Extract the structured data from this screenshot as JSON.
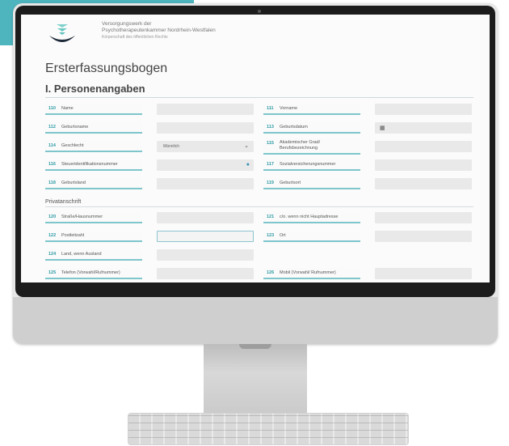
{
  "organization": {
    "line1": "Versorgungswerk der",
    "line2": "Psychotherapeutenkammer Nordrhein-Westfalen",
    "line3": "Körperschaft des öffentlichen Rechts"
  },
  "form": {
    "title": "Ersterfassungsbogen",
    "section": "I. Personenangaben",
    "subsection": "Privatanschrift"
  },
  "fields": [
    {
      "num": "110",
      "label": "Name"
    },
    {
      "num": "111",
      "label": "Vorname"
    },
    {
      "num": "112",
      "label": "Geburtsname"
    },
    {
      "num": "113",
      "label": "Geburtsdatum"
    },
    {
      "num": "114",
      "label": "Geschlecht",
      "value": "Männlich"
    },
    {
      "num": "115",
      "label": "Akademischer Grad/ Berufsbezeichnung"
    },
    {
      "num": "116",
      "label": "Steueridentifikationsnummer"
    },
    {
      "num": "117",
      "label": "Sozialversicherungsnummer"
    },
    {
      "num": "118",
      "label": "Geburtsland"
    },
    {
      "num": "119",
      "label": "Geburtsort"
    },
    {
      "num": "120",
      "label": "Straße/Hausnummer"
    },
    {
      "num": "121",
      "label": "c/o. wenn nicht Hauptadresse"
    },
    {
      "num": "122",
      "label": "Postleitzahl"
    },
    {
      "num": "123",
      "label": "Ort"
    },
    {
      "num": "124",
      "label": "Land, wenn Ausland"
    },
    {
      "num": "125",
      "label": "Telefon (Vorwahl/Rufnummer)"
    },
    {
      "num": "126",
      "label": "Mobil (Vorwahl/ Rufnummer)"
    }
  ],
  "icons": {
    "calendar": "calendar-icon",
    "dropdown": "chevron-down-icon",
    "info": "info-icon"
  },
  "colors": {
    "accent": "#2b9aa5",
    "brand_teal": "#2fa8b4"
  }
}
